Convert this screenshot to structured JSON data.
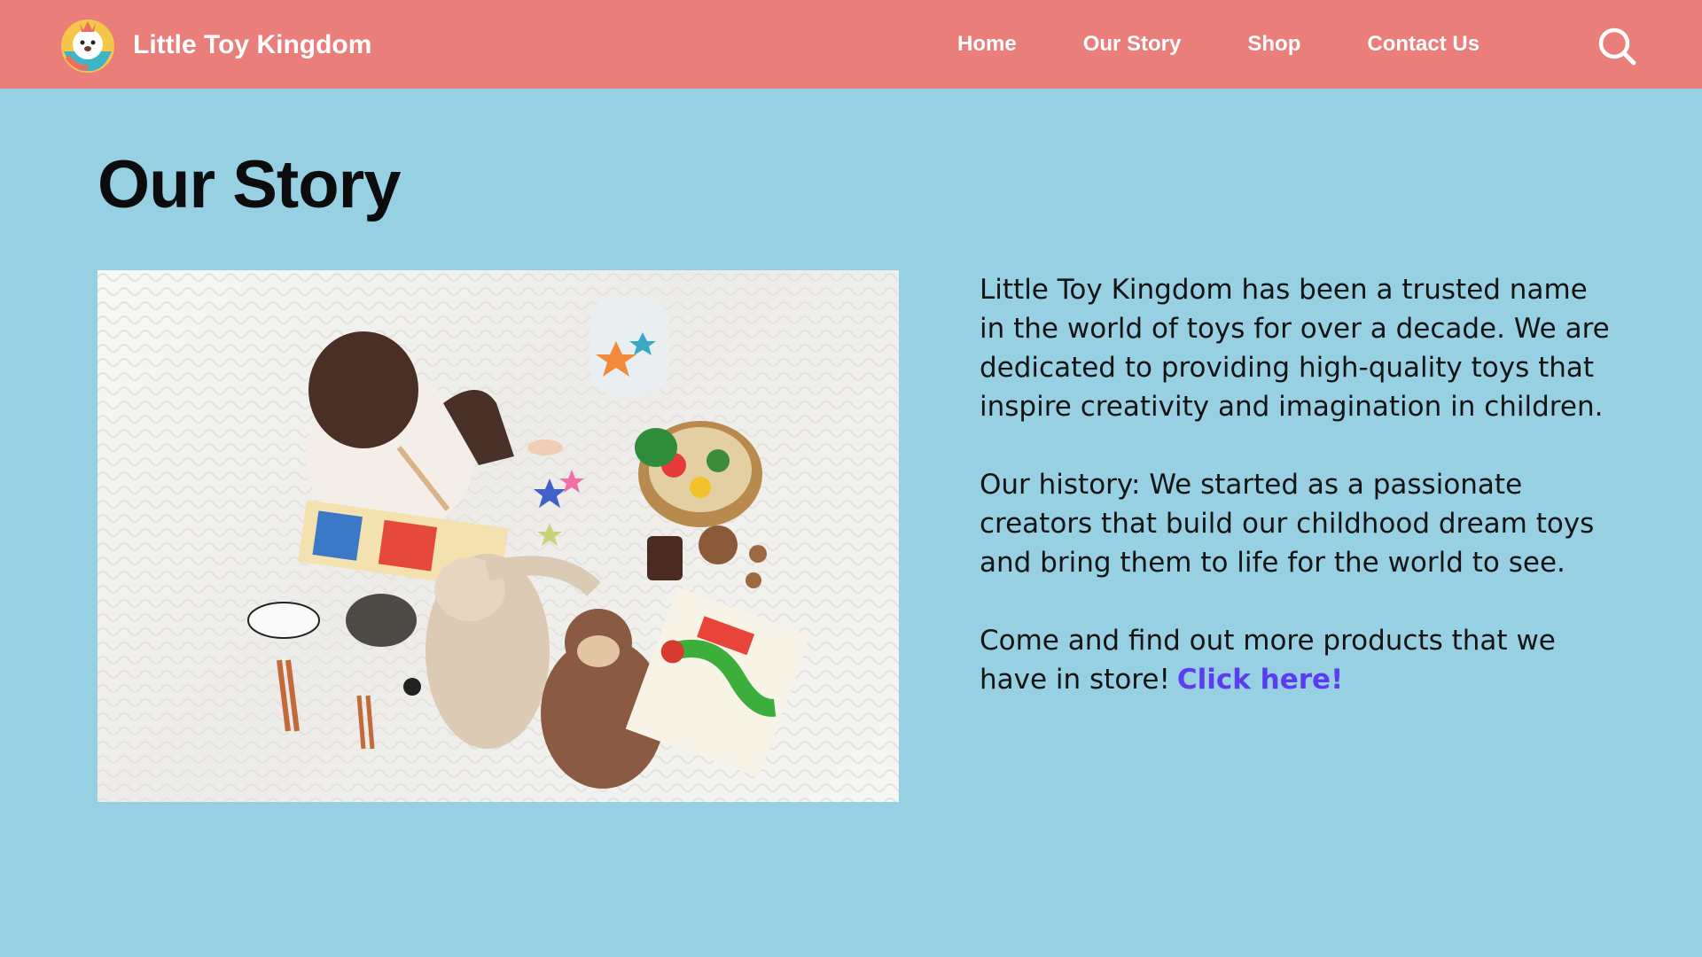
{
  "header": {
    "brand_name": "Little Toy Kingdom",
    "logo_icon": "lion-mascot-icon",
    "nav": [
      {
        "label": "Home"
      },
      {
        "label": "Our Story"
      },
      {
        "label": "Shop"
      },
      {
        "label": "Contact Us"
      }
    ],
    "search_icon": "search-icon",
    "background_color": "#e97e7a"
  },
  "main": {
    "title": "Our Story",
    "photo_alt": "Baby playing with toys on a white blanket",
    "paragraphs": [
      "Little Toy Kingdom has been a trusted name in the world of toys for over a decade. We are dedicated to providing high-quality toys that inspire creativity and imagination in children.",
      "Our history: We started as a passionate creators that build our childhood dream toys and bring them to life for the world to see."
    ],
    "cta_text": "Come and find out more products that we have in store!",
    "cta_link": "Click here!",
    "link_color": "#5b3cf0",
    "background_color": "#97d0e3"
  }
}
